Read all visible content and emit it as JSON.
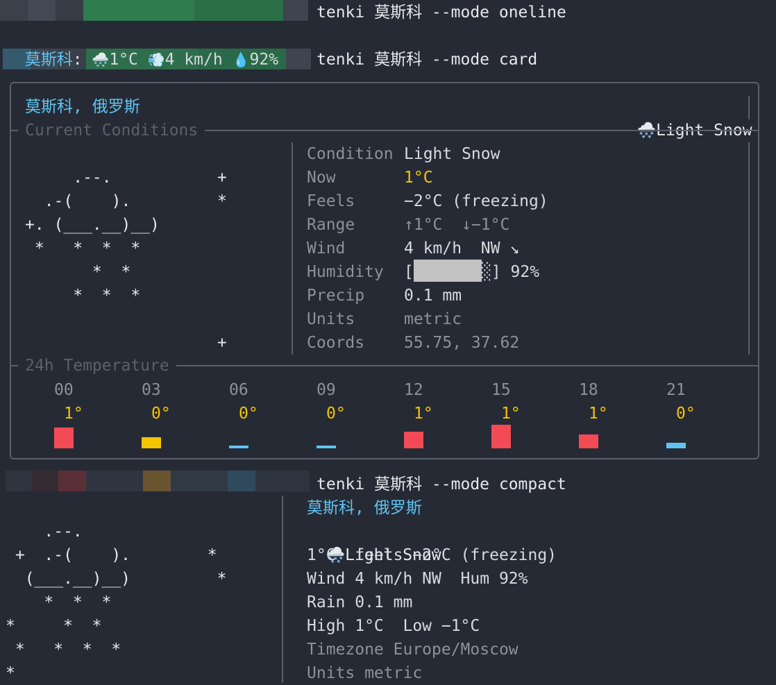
{
  "prompts": {
    "oneline_cmd": "tenki 莫斯科 --mode oneline",
    "card_cmd": "tenki 莫斯科 --mode card",
    "compact_cmd": "tenki 莫斯科 --mode compact"
  },
  "oneline": {
    "city": "莫斯科",
    "sep": ":",
    "snow_icon": "🌨️",
    "temp": "1°C",
    "wind_icon": "💨",
    "wind": "4 km/h",
    "drop_icon": "💧",
    "humidity": "92%"
  },
  "card": {
    "location": "莫斯科, 俄罗斯",
    "condition_icon": "🌨️",
    "condition_text": "Light Snow",
    "section_current": "Current Conditions",
    "section_temp": "24h Temperature",
    "ascii_art": [
      "",
      "     .--.           +",
      "  .-(    ).         *",
      "+. (___.__)__)",
      " *   *  *  *",
      "       *  *",
      "     *  *  *",
      "",
      "                    +"
    ],
    "rows": [
      {
        "label": "Condition",
        "value": "Light Snow"
      },
      {
        "label": "Now",
        "value": "1°C"
      },
      {
        "label": "Feels",
        "value": "−2°C (freezing)"
      },
      {
        "label": "Range",
        "value": "↑1°C  ↓−1°C"
      },
      {
        "label": "Wind",
        "value": "4 km/h  NW ↘"
      },
      {
        "label": "Humidity",
        "value_prefix": "[",
        "value_suffix": "░] 92%",
        "fraction": 0.92
      },
      {
        "label": "Precip",
        "value": "0.1 mm"
      },
      {
        "label": "Units",
        "value": "metric"
      },
      {
        "label": "Coords",
        "value": "55.75, 37.62"
      }
    ],
    "hours": [
      {
        "hour": "00",
        "temp": "1°",
        "value": 1
      },
      {
        "hour": "03",
        "temp": "0°",
        "value": 0
      },
      {
        "hour": "06",
        "temp": "0°",
        "value": 0
      },
      {
        "hour": "09",
        "temp": "0°",
        "value": 0
      },
      {
        "hour": "12",
        "temp": "1°",
        "value": 1
      },
      {
        "hour": "15",
        "temp": "1°",
        "value": 1
      },
      {
        "hour": "18",
        "temp": "1°",
        "value": 1
      },
      {
        "hour": "21",
        "temp": "0°",
        "value": 0
      }
    ]
  },
  "compact": {
    "ascii_art": [
      "",
      "    .--.",
      " +  .-(    ).        *",
      "  (___.__)__)         *",
      "    *  *  *",
      "*     *  *",
      " *   *  *  *",
      "*"
    ],
    "location": "莫斯科, 俄罗斯",
    "condition_icon": "🌨️",
    "condition_text": "Light Snow",
    "temp_line": "1°C  feels −2°C (freezing)",
    "wind_line": "Wind 4 km/h NW  Hum 92%",
    "rain_line": "Rain 0.1 mm",
    "hilo_line": "High 1°C  Low −1°C",
    "tz_line": "Timezone Europe/Moscow",
    "units_line": "Units metric"
  },
  "colors": {
    "background": "#262a35",
    "accent_cyan": "#5ec4f0",
    "temp_yellow": "#f5c400",
    "bar_warm": "#f24b55",
    "bar_zero": "#f5c400",
    "bar_cold": "#5ec4f0",
    "border": "#5a5f6b"
  }
}
